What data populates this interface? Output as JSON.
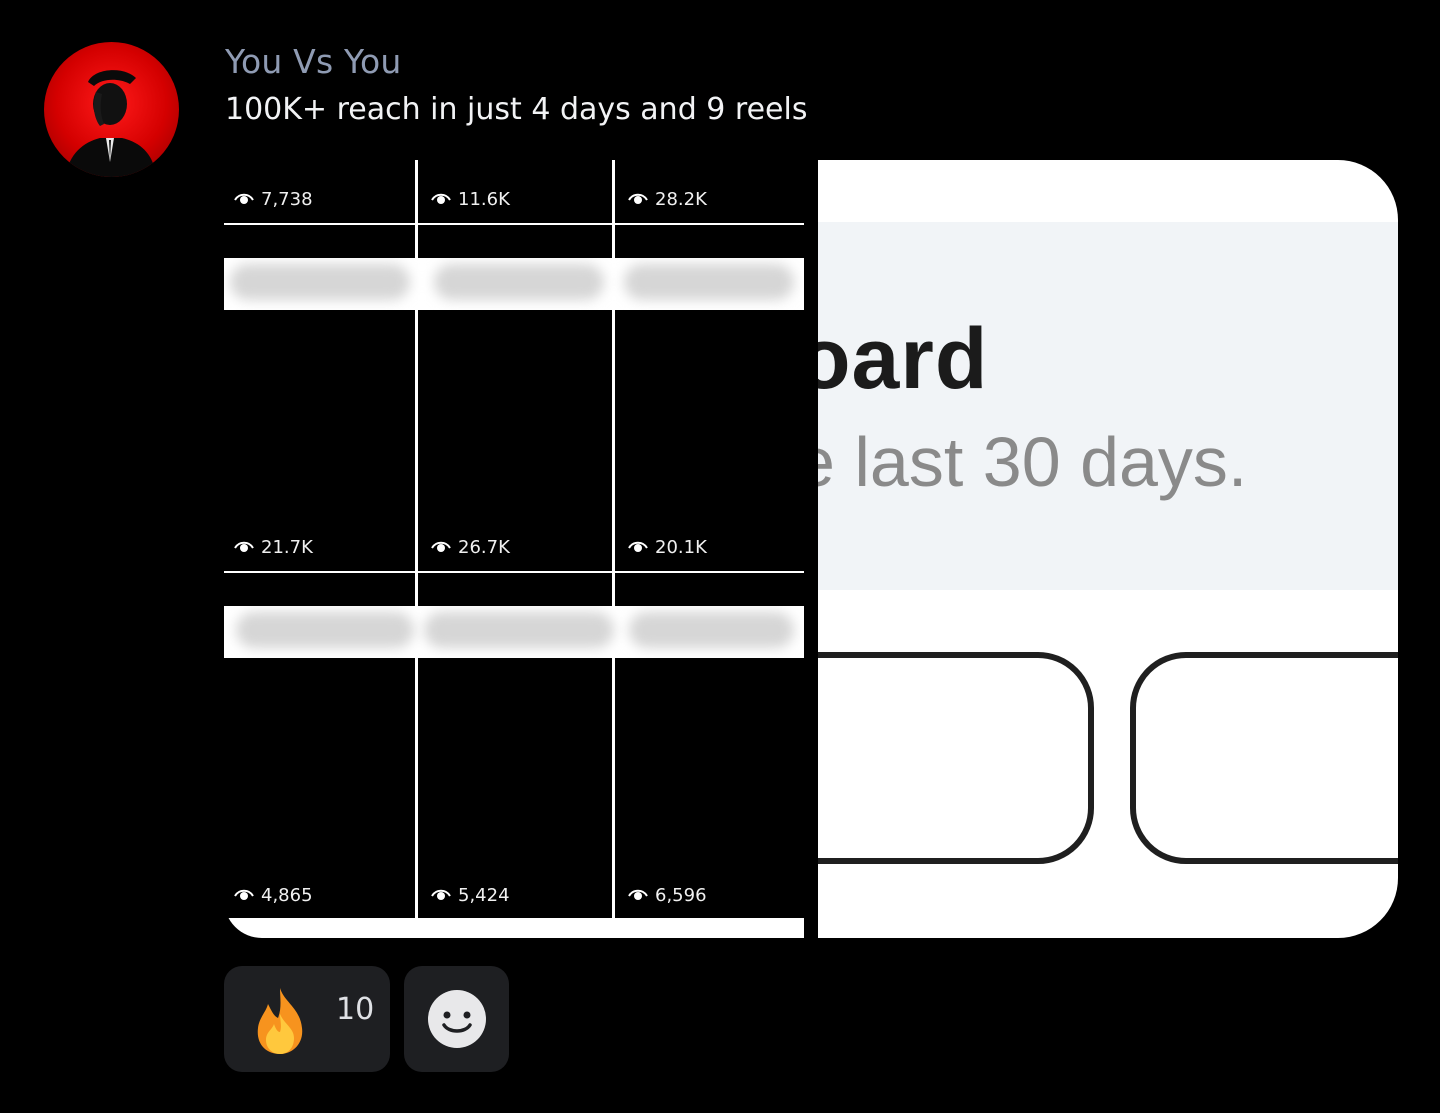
{
  "message": {
    "author": "You Vs You",
    "text": "100K+ reach in just 4 days and 9 reels"
  },
  "reels_grid": {
    "views": [
      "7,738",
      "11.6K",
      "28.2K",
      "21.7K",
      "26.7K",
      "20.1K",
      "4,865",
      "5,424",
      "6,596"
    ]
  },
  "dashboard_crop": {
    "title_fragment": "oard",
    "subtitle_fragment": "e last 30 days."
  },
  "reactions": [
    {
      "icon": "fire-emoji-icon",
      "count": "10"
    },
    {
      "icon": "add-reaction-smiley-icon",
      "count": ""
    }
  ],
  "colors": {
    "background": "#000000",
    "author": "#8f9bb3",
    "reaction_bg": "#1e1f22",
    "avatar_red": "#d40000"
  }
}
